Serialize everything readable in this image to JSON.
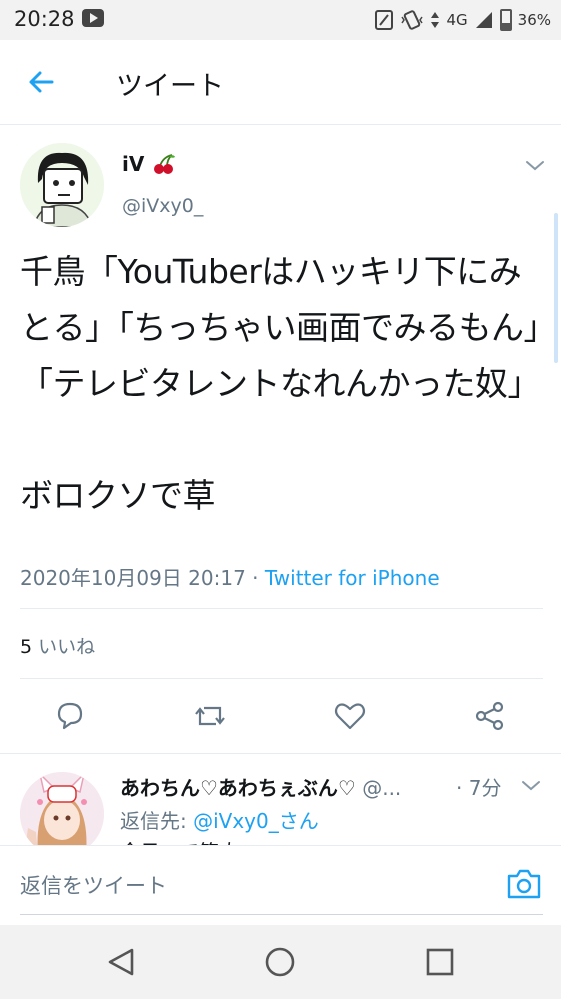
{
  "status_bar": {
    "time": "20:28",
    "network": "4G",
    "battery": "36%"
  },
  "header": {
    "title": "ツイート"
  },
  "tweet": {
    "display_name": "iV",
    "emoji": "🍒",
    "handle": "@iVxy0_",
    "text": "千鳥「YouTuberはハッキリ下にみとる」「ちっちゃい画面でみるもん」「テレビタレントなれんかった奴」\n\nボロクソで草",
    "timestamp": "2020年10月09日 20:17",
    "separator": " · ",
    "source": "Twitter for iPhone",
    "like_count": "5",
    "like_label": "いいね"
  },
  "reply": {
    "display_name": "あわちん♡あわちぇぶん♡",
    "handle": "@...",
    "time": "· 7分",
    "reply_to_label": "返信先: ",
    "reply_to_mention": "@iVxy0_さん",
    "body_partial": "今日って筋肉"
  },
  "composer": {
    "placeholder": "返信をツイート"
  },
  "colors": {
    "accent": "#1da1f2",
    "muted": "#657786",
    "text": "#14171a",
    "divider": "#e6ecf0"
  }
}
